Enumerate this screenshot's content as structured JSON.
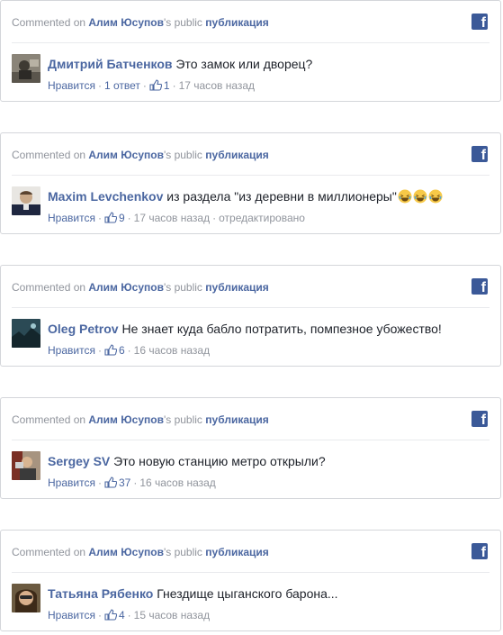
{
  "header": {
    "commented_on": "Commented on",
    "page_owner": "Алим Юсупов",
    "possessive_suffix": "'s public",
    "post_link": "публикация",
    "logo_letter": "f"
  },
  "actions": {
    "like": "Нравится",
    "reply": "1 ответ",
    "edited": "отредактировано"
  },
  "comments": [
    {
      "author": "Дмитрий Батченков",
      "text": "Это замок или дворец?",
      "likes": "1",
      "time": "17 часов назад",
      "reply": "1 ответ"
    },
    {
      "author": "Maxim Levchenkov",
      "text": "из раздела \"из деревни в миллионеры\"",
      "likes": "9",
      "time": "17 часов назад",
      "edited": "отредактировано",
      "emoji": "laughing-face-icon"
    },
    {
      "author": "Oleg Petrov",
      "text": "Не знает куда бабло потратить, помпезное убожество!",
      "likes": "6",
      "time": "16 часов назад"
    },
    {
      "author": "Sergey SV",
      "text": "Это новую станцию метро открыли?",
      "likes": "37",
      "time": "16 часов назад"
    },
    {
      "author": "Татьяна Рябенко",
      "text": "Гнездище цыганского барона...",
      "likes": "4",
      "time": "15 часов назад"
    }
  ],
  "colors": {
    "link_blue": "#4b67a1",
    "meta_gray": "#90949c",
    "facebook_blue": "#3b5998",
    "border": "#d4d6da"
  }
}
